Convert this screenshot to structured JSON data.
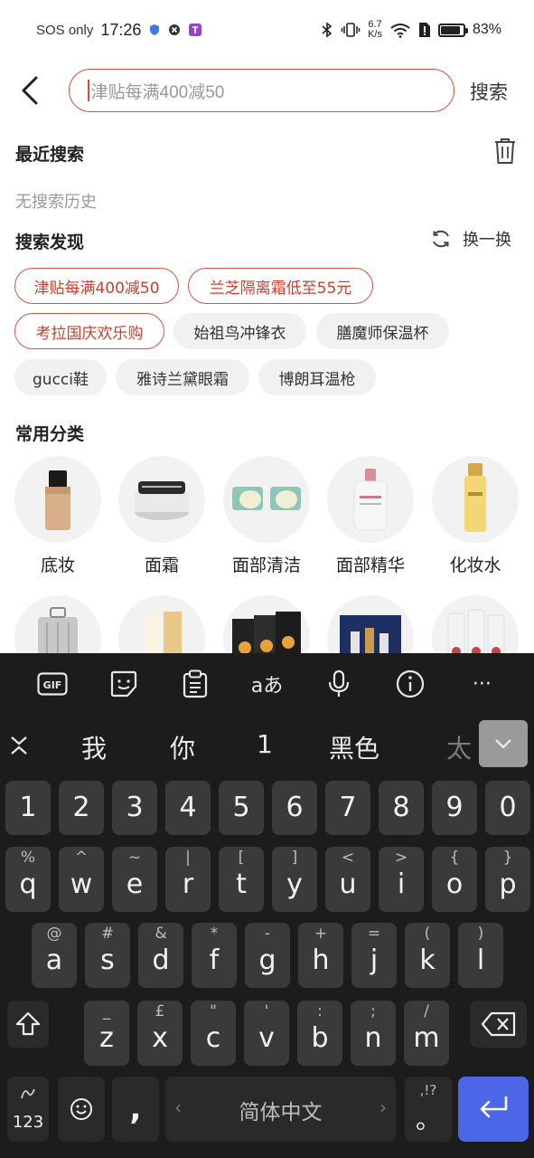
{
  "status_bar": {
    "carrier": "SOS only",
    "time": "17:26",
    "speed_value": "6.7",
    "speed_unit": "K/s",
    "battery": "83%"
  },
  "search": {
    "placeholder": "津贴每满400减50",
    "button": "搜索"
  },
  "recent": {
    "title": "最近搜索",
    "empty": "无搜索历史"
  },
  "discover": {
    "title": "搜索发现",
    "refresh_label": "换一换",
    "tags": [
      {
        "label": "津贴每满400减50",
        "hot": true
      },
      {
        "label": "兰芝隔离霜低至55元",
        "hot": true
      },
      {
        "label": "考拉国庆欢乐购",
        "hot": true
      },
      {
        "label": "始祖鸟冲锋衣",
        "hot": false
      },
      {
        "label": "膳魔师保温杯",
        "hot": false
      },
      {
        "label": "gucci鞋",
        "hot": false
      },
      {
        "label": "雅诗兰黛眼霜",
        "hot": false
      },
      {
        "label": "博朗耳温枪",
        "hot": false
      }
    ]
  },
  "categories": {
    "title": "常用分类",
    "items": [
      {
        "label": "底妆",
        "icon": "foundation-bottle-icon"
      },
      {
        "label": "面霜",
        "icon": "cream-jar-icon"
      },
      {
        "label": "面部清洁",
        "icon": "cleansing-balm-icon"
      },
      {
        "label": "面部精华",
        "icon": "serum-bottle-icon"
      },
      {
        "label": "化妆水",
        "icon": "toner-bottle-icon"
      }
    ]
  },
  "keyboard": {
    "toolbar": [
      "gif-icon",
      "sticker-icon",
      "clipboard-icon",
      "translate-icon",
      "microphone-icon",
      "info-icon",
      "more-icon"
    ],
    "translate_glyph": "aあ",
    "more_glyph": "···",
    "gif_label": "GIF",
    "candidates": [
      "我",
      "你",
      "1",
      "黑色",
      "太"
    ],
    "number_row": [
      "1",
      "2",
      "3",
      "4",
      "5",
      "6",
      "7",
      "8",
      "9",
      "0"
    ],
    "row1": [
      {
        "k": "q",
        "s": "%"
      },
      {
        "k": "w",
        "s": "^"
      },
      {
        "k": "e",
        "s": "~"
      },
      {
        "k": "r",
        "s": "|"
      },
      {
        "k": "t",
        "s": "["
      },
      {
        "k": "y",
        "s": "]"
      },
      {
        "k": "u",
        "s": "<"
      },
      {
        "k": "i",
        "s": ">"
      },
      {
        "k": "o",
        "s": "{"
      },
      {
        "k": "p",
        "s": "}"
      }
    ],
    "row2": [
      {
        "k": "a",
        "s": "@"
      },
      {
        "k": "s",
        "s": "#"
      },
      {
        "k": "d",
        "s": "&"
      },
      {
        "k": "f",
        "s": "*"
      },
      {
        "k": "g",
        "s": "-"
      },
      {
        "k": "h",
        "s": "+"
      },
      {
        "k": "j",
        "s": "="
      },
      {
        "k": "k",
        "s": "("
      },
      {
        "k": "l",
        "s": ")"
      }
    ],
    "row3": [
      {
        "k": "z",
        "s": "_"
      },
      {
        "k": "x",
        "s": "£"
      },
      {
        "k": "c",
        "s": "\""
      },
      {
        "k": "v",
        "s": "'"
      },
      {
        "k": "b",
        "s": ":"
      },
      {
        "k": "n",
        "s": ";"
      },
      {
        "k": "m",
        "s": "/"
      }
    ],
    "numbers_key": "123",
    "comma_key": ",",
    "space_label": "简体中文",
    "punct_key_main": "。",
    "punct_key_sub": ",!?"
  }
}
